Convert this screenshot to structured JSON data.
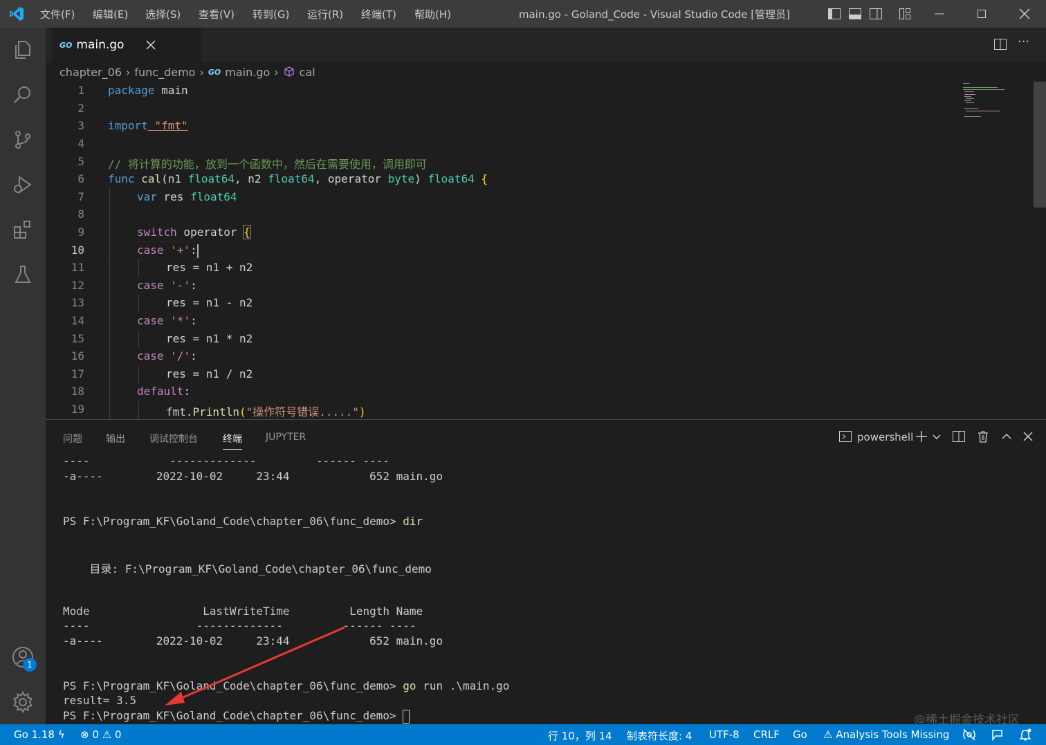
{
  "titlebar": {
    "menus": [
      "文件(F)",
      "编辑(E)",
      "选择(S)",
      "查看(V)",
      "转到(G)",
      "运行(R)",
      "终端(T)",
      "帮助(H)"
    ],
    "title": "main.go - Goland_Code - Visual Studio Code [管理员]"
  },
  "tab": {
    "icon_text": "GO",
    "label": "main.go"
  },
  "breadcrumb": {
    "items": [
      "chapter_06",
      "func_demo",
      "main.go",
      "cal"
    ],
    "go_icon": "GO"
  },
  "editor": {
    "line_numbers": [
      "1",
      "2",
      "3",
      "4",
      "5",
      "6",
      "7",
      "8",
      "9",
      "10",
      "11",
      "12",
      "13",
      "14",
      "15",
      "16",
      "17",
      "18",
      "19"
    ],
    "current_line": "10",
    "code": {
      "l1_a": "package",
      "l1_b": " main",
      "l3_a": "import",
      "l3_b": " \"fmt\"",
      "l5": "// 将计算的功能，放到一个函数中，然后在需要使用，调用即可",
      "l6_func": "func",
      "l6_name": " cal",
      "l6_p1": "(n1 ",
      "l6_t1": "float64",
      "l6_p2": ", n2 ",
      "l6_t2": "float64",
      "l6_p3": ", operator ",
      "l6_t3": "byte",
      "l6_p4": ") ",
      "l6_t4": "float64",
      "l6_brace": " {",
      "l7_a": "var",
      "l7_b": " res ",
      "l7_c": "float64",
      "l9_a": "switch",
      "l9_b": " operator ",
      "l9_c": "{",
      "l10_a": "case",
      "l10_b": " '+'",
      "l10_c": ":",
      "l11": "res = n1 + n2",
      "l12_a": "case",
      "l12_b": " '-'",
      "l12_c": ":",
      "l13": "res = n1 - n2",
      "l14_a": "case",
      "l14_b": " '*'",
      "l14_c": ":",
      "l15": "res = n1 * n2",
      "l16_a": "case",
      "l16_b": " '/'",
      "l16_c": ":",
      "l17": "res = n1 / n2",
      "l18_a": "default",
      "l18_b": ":",
      "l19_a": "fmt.",
      "l19_b": "Println",
      "l19_c": "(",
      "l19_d": "\"操作符号错误.....\"",
      "l19_e": ")"
    }
  },
  "panel": {
    "tabs": [
      "问题",
      "输出",
      "调试控制台",
      "终端",
      "JUPYTER"
    ],
    "active_tab": "终端",
    "shell": "powershell",
    "terminal_lines": [
      "----            -------------         ------ ----",
      "-a----        2022-10-02     23:44            652 main.go",
      "",
      "",
      "PS F:\\Program_KF\\Goland_Code\\chapter_06\\func_demo> ",
      "",
      "",
      "    目录: F:\\Program_KF\\Goland_Code\\chapter_06\\func_demo",
      "",
      "",
      "Mode                 LastWriteTime         Length Name",
      "----                -------------         ------ ----",
      "-a----        2022-10-02     23:44            652 main.go",
      "",
      "",
      "PS F:\\Program_KF\\Goland_Code\\chapter_06\\func_demo> ",
      "result= 3.5",
      "PS F:\\Program_KF\\Goland_Code\\chapter_06\\func_demo> "
    ],
    "cmd_dir": "dir",
    "cmd_go": "go",
    "cmd_go_rest": " run .\\main.go",
    "watermark": "@稀土掘金技术社区"
  },
  "status": {
    "go_version": "Go 1.18",
    "errors": "0",
    "warnings": "0",
    "position": "行 10，列 14",
    "tab_size": "制表符长度: 4",
    "encoding": "UTF-8",
    "eol": "CRLF",
    "language": "Go",
    "analysis": "Analysis Tools Missing"
  },
  "accounts_badge": "1",
  "colors": {
    "accent": "#007acc",
    "arrow": "#e53935"
  }
}
